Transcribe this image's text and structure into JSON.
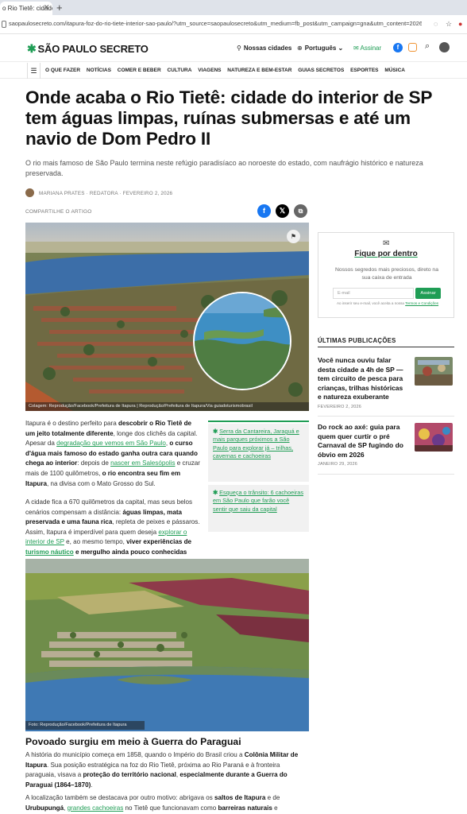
{
  "browser": {
    "tab_title": "o Rio Tietê: cidade",
    "url": "saopaulosecreto.com/itapura-foz-do-rio-tiete-interior-sao-paulo/?utm_source=saopaulosecreto&utm_medium=fb_post&utm_campaign=gna&utm_content=20260202172117fb_..."
  },
  "header": {
    "logo": "SÃO PAULO SECRETO",
    "nossas_cidades": "Nossas cidades",
    "language": "Português",
    "assinar": "Assinar"
  },
  "nav": {
    "items": [
      "O QUE FAZER",
      "NOTÍCIAS",
      "COMER E BEBER",
      "CULTURA",
      "VIAGENS",
      "NATUREZA E BEM-ESTAR",
      "GUIAS SECRETOS",
      "ESPORTES",
      "MÚSICA"
    ]
  },
  "article": {
    "headline": "Onde acaba o Rio Tietê: cidade do interior de SP tem águas limpas, ruínas submersas e até um navio de Dom Pedro II",
    "subhead": "O rio mais famoso de São Paulo termina neste refúgio paradisíaco ao noroeste do estado, com naufrágio histórico e natureza preservada.",
    "author": "MARIANA PRATES · REDATORA",
    "date": "FEVEREIRO 2, 2026",
    "share_label": "COMPARTILHE O ARTIGO",
    "hero_caption": "Colagem: Reprodução/Facebook/Prefeitura de Itapura | Reprodução/Prefeitura de Itapura/Via guiadoturismobrasil",
    "img2_caption": "Foto: Reprodução/Facebook/Prefeitura de Itapura",
    "section_title": "Povoado surgiu em meio à Guerra do Paraguai",
    "p1": {
      "t1": "Itapura é o destino perfeito para ",
      "b1": "descobrir o Rio Tietê de um jeito totalmente diferente",
      "t2": ", longe dos clichês da capital. Apesar da ",
      "a1": "degradação que vemos em São Paulo",
      "t3": ", ",
      "b2": "o curso d'água mais famoso do estado ganha outra cara quando chega ao interior",
      "t4": ": depois de ",
      "a2": "nascer em Salesópolis",
      "t5": " e cruzar mais de 1100 quilômetros, ",
      "b3": "o rio encontra seu fim em Itapura",
      "t6": ", na divisa com o Mato Grosso do Sul."
    },
    "p2": {
      "t1": "A cidade fica a 670 quilômetros da capital, mas seus belos cenários compensam a distância: ",
      "b1": "águas limpas, mata preservada e uma fauna rica",
      "t2": ", repleta de peixes e pássaros. Assim, Itapura é imperdível para quem deseja ",
      "a1": "explorar o interior de SP",
      "t3": " e, ao mesmo tempo, ",
      "b2": "viver experiências de ",
      "a2": "turismo náutico",
      "b3": " e mergulho ainda pouco conhecidas pelo público."
    },
    "p3": {
      "t1": "A história do município começa em 1858, quando o Império do Brasil criou a ",
      "b1": "Colônia Militar de Itapura",
      "t2": ". Sua posição estratégica na foz do Rio Tietê, próxima ao Rio Paraná e à fronteira paraguaia, visava a ",
      "b2": "proteção do território nacional",
      "t3": ", ",
      "b3": "especialmente durante a Guerra do Paraguai (1864–1870)",
      "t4": "."
    },
    "p4": {
      "t1": "A localização também se destacava por outro motivo: abrigava os ",
      "b1": "saltos de Itapura",
      "t2": " e de ",
      "b2": "Urubupungá",
      "t3": ", ",
      "a1": "grandes cachoeiras",
      "t4": " no Tietê que funcionavam como ",
      "b3": "barreiras naturais",
      "t5": " e"
    },
    "related": [
      "Serra da Cantareira, Jaraguá e mais parques próximos a São Paulo para explorar já – trilhas, cavernas e cachoeiras",
      "Esqueça o trânsito: 6 cachoeiras em São Paulo que farão você sentir que saiu da capital"
    ]
  },
  "sidebar": {
    "card_title": "Fique por dentro",
    "card_desc": "Nossos segredos mais preciosos, direto na sua caixa de entrada",
    "email_placeholder": "E-mail",
    "card_button": "Assinar",
    "legal_text": "Ao inserir seu e-mail, você aceita a nossa ",
    "legal_link": "Termos e Condições",
    "pub_heading": "ÚLTIMAS PUBLICAÇÕES",
    "pubs": [
      {
        "title": "Você nunca ouviu falar desta cidade a 4h de SP — tem circuito de pesca para crianças, trilhas históricas e natureza exuberante",
        "date": "FEVEREIRO 2, 2026"
      },
      {
        "title": "Do rock ao axé: guia para quem quer curtir o pré Carnaval de SP fugindo do óbvio em 2026",
        "date": "JANEIRO 29, 2026"
      }
    ]
  },
  "colors": {
    "brand_green": "#1f9d55",
    "facebook": "#1877f2",
    "x": "#000000"
  }
}
